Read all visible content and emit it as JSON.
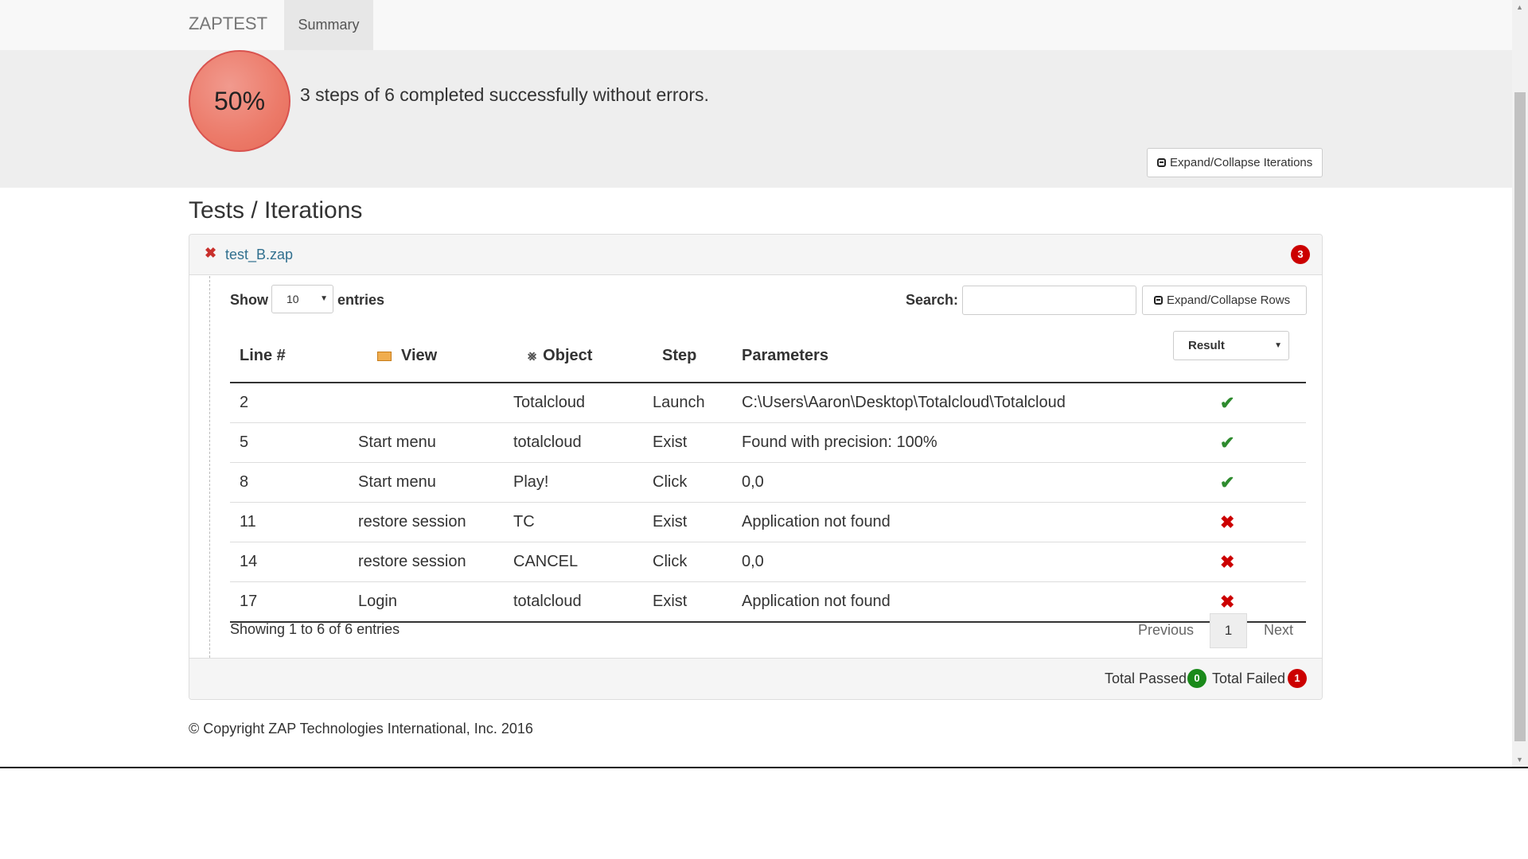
{
  "navbar": {
    "brand": "ZAPTEST",
    "tab_summary": "Summary"
  },
  "summary": {
    "progress_percent": 50,
    "progress_label": "50%",
    "message": "3 steps of 6 completed successfully without errors.",
    "expand_iterations_label": "Expand/Collapse Iterations"
  },
  "section_title": "Tests / Iterations",
  "test": {
    "name": "test_B.zap",
    "error_count": "3",
    "show_label": "Show",
    "entries_select_value": "10",
    "entries_label": "entries",
    "search_label": "Search:",
    "search_value": "",
    "expand_rows_label": "Expand/Collapse Rows",
    "result_filter_value": "Result",
    "columns": {
      "line": "Line #",
      "view": "View",
      "object": "Object",
      "step": "Step",
      "parameters": "Parameters"
    },
    "rows": [
      {
        "line": "2",
        "view": "",
        "object": "Totalcloud",
        "step": "Launch",
        "parameters": "C:\\Users\\Aaron\\Desktop\\Totalcloud\\Totalcloud",
        "result": "pass"
      },
      {
        "line": "5",
        "view": "Start menu",
        "object": "totalcloud",
        "step": "Exist",
        "parameters": "Found with precision: 100%",
        "result": "pass"
      },
      {
        "line": "8",
        "view": "Start menu",
        "object": "Play!",
        "step": "Click",
        "parameters": "0,0",
        "result": "pass"
      },
      {
        "line": "11",
        "view": "restore session",
        "object": "TC",
        "step": "Exist",
        "parameters": "Application not found",
        "result": "fail"
      },
      {
        "line": "14",
        "view": "restore session",
        "object": "CANCEL",
        "step": "Click",
        "parameters": "0,0",
        "result": "fail"
      },
      {
        "line": "17",
        "view": "Login",
        "object": "totalcloud",
        "step": "Exist",
        "parameters": "Application not found",
        "result": "fail"
      }
    ],
    "showing_text": "Showing 1 to 6 of 6 entries",
    "pagination": {
      "previous": "Previous",
      "current": "1",
      "next": "Next"
    },
    "totals": {
      "passed_label": "Total Passed",
      "passed_count": "0",
      "failed_label": "Total Failed",
      "failed_count": "1"
    }
  },
  "footer": {
    "copyright": "© Copyright ZAP Technologies International, Inc. 2016"
  },
  "colors": {
    "pass": "#2e8b2e",
    "fail": "#cc0000",
    "parameter_text": "#a93232",
    "progress_fill": "#ec7a69"
  },
  "icons": {
    "view_column": "monitor-icon",
    "object_column": "share-icon",
    "pass": "check-icon",
    "fail": "cross-icon"
  }
}
